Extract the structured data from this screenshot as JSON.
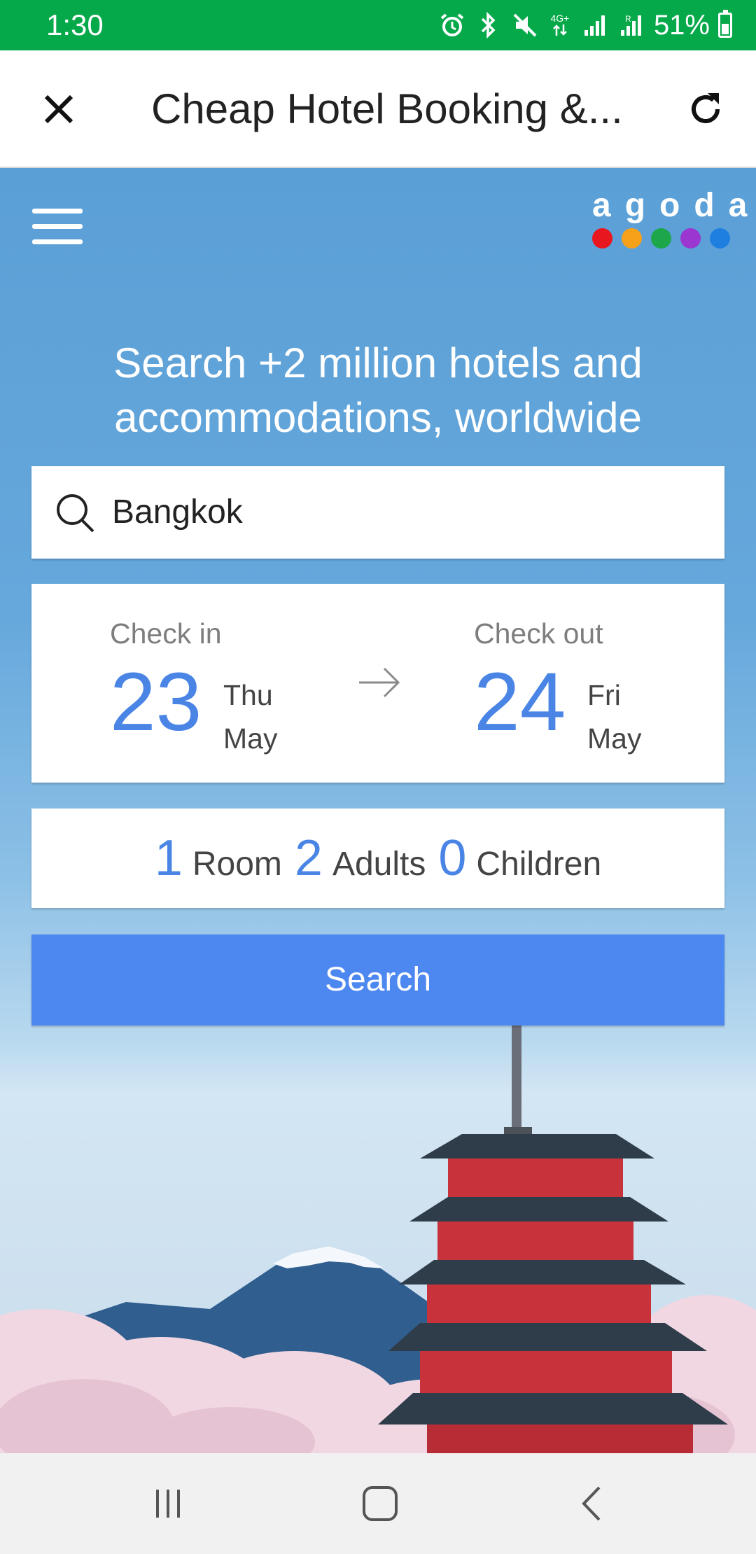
{
  "status_bar": {
    "time": "1:30",
    "network": "4G+",
    "battery": "51%",
    "battery_level": 0.51,
    "icons": [
      "alarm-icon",
      "bluetooth-icon",
      "mute-icon",
      "network-icon",
      "signal-icon",
      "signal-roaming-icon",
      "battery-icon"
    ]
  },
  "title_bar": {
    "title": "Cheap Hotel Booking &...",
    "close_icon": "close-icon",
    "reload_icon": "reload-icon"
  },
  "hero": {
    "logo_text": "agoda",
    "logo_colors": [
      "#e8161e",
      "#f7a11a",
      "#1ea64a",
      "#9b36d1",
      "#1e7fe0"
    ],
    "headline_line1": "Search +2 million hotels and",
    "headline_line2": "accommodations, worldwide"
  },
  "search": {
    "value": "Bangkok",
    "icon": "search-icon"
  },
  "dates": {
    "check_in": {
      "label": "Check in",
      "day": "23",
      "weekday": "Thu",
      "month": "May"
    },
    "check_out": {
      "label": "Check out",
      "day": "24",
      "weekday": "Fri",
      "month": "May"
    }
  },
  "guests": {
    "rooms": "1",
    "rooms_label": "Room",
    "adults": "2",
    "adults_label": "Adults",
    "children": "0",
    "children_label": "Children"
  },
  "search_button": "Search",
  "colors": {
    "status_bar": "#06a94a",
    "accent_blue": "#4a85e6",
    "button_blue": "#4d87f0"
  },
  "nav_bar": {
    "icons": [
      "recent-apps-icon",
      "home-icon",
      "back-icon"
    ]
  }
}
